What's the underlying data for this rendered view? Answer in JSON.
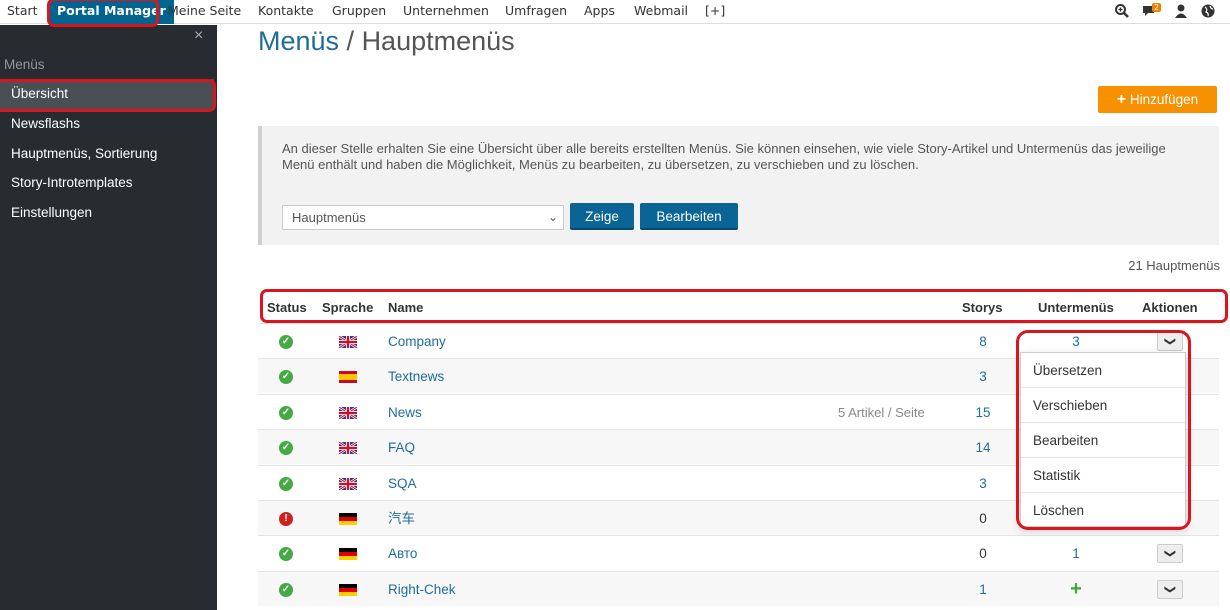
{
  "topnav": {
    "items": [
      "Start",
      "Portal Manager",
      "Meine Seite",
      "Kontakte",
      "Gruppen",
      "Unternehmen",
      "Umfragen",
      "Apps",
      "Webmail",
      "[+]"
    ],
    "message_badge": "2",
    "icons": [
      "search-zoom-icon",
      "chat-icon",
      "user-icon",
      "globe-icon"
    ]
  },
  "sidebar": {
    "close": "×",
    "title": "Menüs",
    "items": [
      "Übersicht",
      "Newsflashs",
      "Hauptmenüs, Sortierung",
      "Story-Introtemplates",
      "Einstellungen"
    ]
  },
  "page": {
    "crumb": "Menüs",
    "separator": " / ",
    "title": "Hauptmenüs",
    "add_button": "Hinzufügen",
    "add_icon": "+"
  },
  "info": {
    "text": "An dieser Stelle erhalten Sie eine Übersicht über alle bereits erstellten Menüs. Sie können einsehen, wie viele Story-Artikel und Untermenüs das jeweilige Menü enthält und haben die Möglichkeit, Menüs zu bearbeiten, zu übersetzen, zu verschieben und zu löschen.",
    "select_value": "Hauptmenüs",
    "show_button": "Zeige",
    "edit_button": "Bearbeiten"
  },
  "count": "21 Hauptmenüs",
  "table": {
    "headers": [
      "Status",
      "Sprache",
      "Name",
      "Storys",
      "Untermenüs",
      "Aktionen"
    ],
    "rows": [
      {
        "status": "ok",
        "lang": "gb",
        "name": "Company",
        "note": "",
        "storys": "8",
        "sub": "3"
      },
      {
        "status": "ok",
        "lang": "es",
        "name": "Textnews",
        "note": "",
        "storys": "3",
        "sub": ""
      },
      {
        "status": "ok",
        "lang": "gb",
        "name": "News",
        "note": "5 Artikel / Seite",
        "storys": "15",
        "sub": ""
      },
      {
        "status": "ok",
        "lang": "gb",
        "name": "FAQ",
        "note": "",
        "storys": "14",
        "sub": ""
      },
      {
        "status": "ok",
        "lang": "gb",
        "name": "SQA",
        "note": "",
        "storys": "3",
        "sub": ""
      },
      {
        "status": "err",
        "lang": "de",
        "name": "汽车",
        "note": "",
        "storys": "0",
        "sub": ""
      },
      {
        "status": "ok",
        "lang": "de",
        "name": "Авто",
        "note": "",
        "storys": "0",
        "sub": "1"
      },
      {
        "status": "ok",
        "lang": "de",
        "name": "Right-Chek",
        "note": "",
        "storys": "1",
        "sub": "+"
      }
    ]
  },
  "dropdown": [
    "Übersetzen",
    "Verschieben",
    "Bearbeiten",
    "Statistik",
    "Löschen"
  ],
  "colors": {
    "accent": "#00648f",
    "highlight": "#d9151e",
    "add": "#f79100"
  }
}
